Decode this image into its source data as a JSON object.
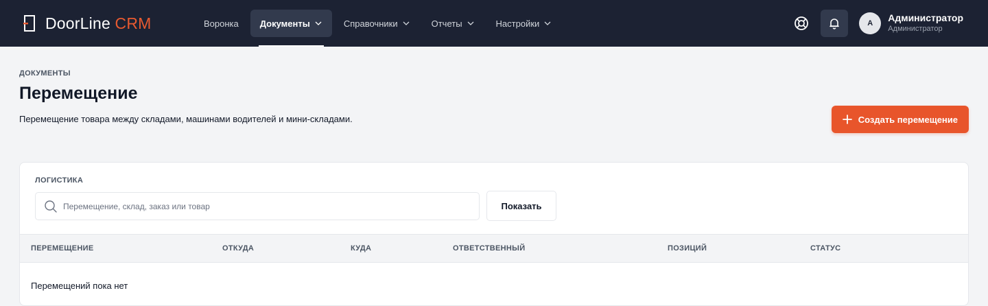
{
  "header": {
    "brand": {
      "name": "DoorLine",
      "accent": "CRM"
    },
    "nav": [
      {
        "label": "Воронка",
        "has_menu": false,
        "active": false
      },
      {
        "label": "Документы",
        "has_menu": true,
        "active": true
      },
      {
        "label": "Справочники",
        "has_menu": true,
        "active": false
      },
      {
        "label": "Отчеты",
        "has_menu": true,
        "active": false
      },
      {
        "label": "Настройки",
        "has_menu": true,
        "active": false
      }
    ],
    "icons": [
      "help-lifebuoy-icon",
      "bell-icon"
    ],
    "user": {
      "avatar_letter": "А",
      "name": "Администратор",
      "role": "Администратор"
    }
  },
  "page": {
    "eyebrow": "ДОКУМЕНТЫ",
    "title": "Перемещение",
    "description": "Перемещение товара между складами, машинами водителей и мини-складами.",
    "create_button": "Создать перемещение"
  },
  "card": {
    "label": "ЛОГИСТИКА",
    "search_placeholder": "Перемещение, склад, заказ или товар",
    "search_value": "",
    "show_button": "Показать",
    "columns": [
      "ПЕРЕМЕЩЕНИЕ",
      "ОТКУДА",
      "КУДА",
      "ОТВЕТСТВЕННЫЙ",
      "ПОЗИЦИЙ",
      "СТАТУС"
    ],
    "empty_text": "Перемещений пока нет"
  },
  "colors": {
    "topbar": "#1c2233",
    "accent": "#e8552b",
    "nav_active_bg": "#323a4d",
    "page_bg": "#f3f4f6"
  }
}
